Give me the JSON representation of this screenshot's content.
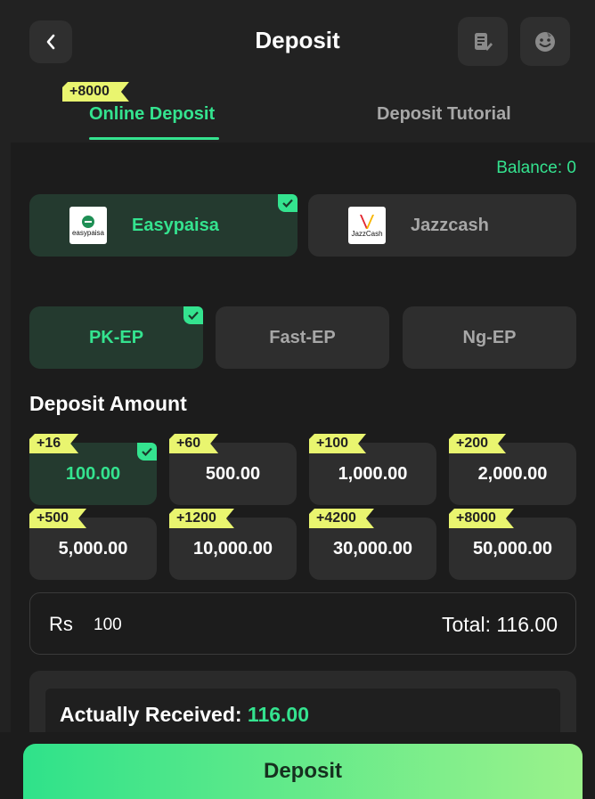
{
  "header": {
    "title": "Deposit",
    "back_icon": "chevron-left-icon",
    "record_icon": "document-edit-icon",
    "service_icon": "emoji-face-icon"
  },
  "tabs": {
    "online_label": "Online Deposit",
    "online_bonus": "+8000",
    "tutorial_label": "Deposit Tutorial"
  },
  "balance_text": "Balance: 0",
  "methods": [
    {
      "name": "Easypaisa",
      "logo_text": "easypaisa",
      "selected": true
    },
    {
      "name": "Jazzcash",
      "logo_text": "JazzCash",
      "selected": false
    }
  ],
  "channels": [
    {
      "name": "PK-EP",
      "selected": true
    },
    {
      "name": "Fast-EP",
      "selected": false
    },
    {
      "name": "Ng-EP",
      "selected": false
    }
  ],
  "amount_section_title": "Deposit Amount",
  "amounts": [
    {
      "value": "100.00",
      "bonus": "+16",
      "selected": true
    },
    {
      "value": "500.00",
      "bonus": "+60",
      "selected": false
    },
    {
      "value": "1,000.00",
      "bonus": "+100",
      "selected": false
    },
    {
      "value": "2,000.00",
      "bonus": "+200",
      "selected": false
    },
    {
      "value": "5,000.00",
      "bonus": "+500",
      "selected": false
    },
    {
      "value": "10,000.00",
      "bonus": "+1200",
      "selected": false
    },
    {
      "value": "30,000.00",
      "bonus": "+4200",
      "selected": false
    },
    {
      "value": "50,000.00",
      "bonus": "+8000",
      "selected": false
    }
  ],
  "input": {
    "currency": "Rs",
    "value": "100",
    "total_text": "Total: 116.00"
  },
  "received": {
    "label": "Actually Received:",
    "value": "116.00"
  },
  "deposit_button_label": "Deposit",
  "colors": {
    "accent": "#34e38f",
    "tag": "#e9f56f",
    "background": "#222222"
  }
}
